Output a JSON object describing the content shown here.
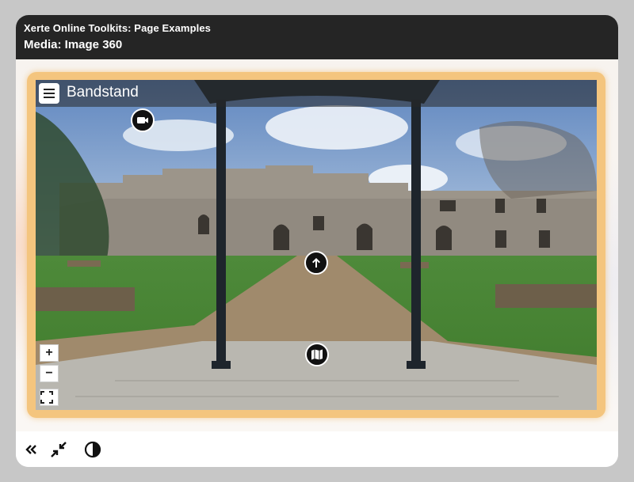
{
  "header": {
    "project_title": "Xerte Online Toolkits: Page Examples",
    "page_title": "Media: Image 360"
  },
  "panorama": {
    "scene_title": "Bandstand",
    "hotspots": [
      {
        "name": "video-hotspot",
        "icon": "video-camera-icon"
      },
      {
        "name": "navigate-forward-hotspot",
        "icon": "arrow-up-icon"
      },
      {
        "name": "map-hotspot",
        "icon": "map-icon"
      }
    ],
    "controls": {
      "zoom_in": "+",
      "zoom_out": "−",
      "fullscreen_icon": "fullscreen-icon"
    }
  },
  "footer": {
    "buttons": [
      "collapse-left-icon",
      "exit-fullscreen-icon",
      "contrast-icon"
    ]
  },
  "colors": {
    "header_bg": "#252525",
    "frame_border": "#f4c57e",
    "page_bg": "#c7c7c7"
  }
}
